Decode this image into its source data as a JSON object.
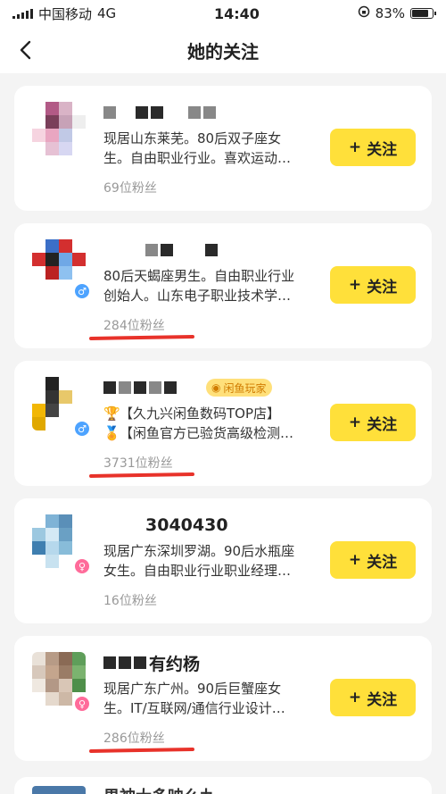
{
  "status": {
    "carrier": "中国移动",
    "network": "4G",
    "time": "14:40",
    "battery": "83%",
    "battery_level": 0.83
  },
  "nav": {
    "title": "她的关注"
  },
  "follow_label": "关注",
  "follow_plus": "+",
  "items": [
    {
      "name": "",
      "desc1": "现居山东莱芜。80后双子座女",
      "desc2": "生。自由职业行业。喜欢运动…",
      "fans": "69位粉丝",
      "gender": "",
      "underlined": false
    },
    {
      "name": "",
      "desc1": "80后天蝎座男生。自由职业行业",
      "desc2": "创始人。山东电子职业技术学…",
      "fans": "284位粉丝",
      "gender": "♂",
      "underlined": true
    },
    {
      "name": "",
      "badge": "闲鱼玩家",
      "desc1": "【久九兴闲鱼数码TOP店】",
      "desc2": "【闲鱼官方已验货高级检测…",
      "fans": "3731位粉丝",
      "gender": "♂",
      "underlined": true
    },
    {
      "name": "3040430",
      "desc1": "现居广东深圳罗湖。90后水瓶座",
      "desc2": "女生。自由职业行业职业经理…",
      "fans": "16位粉丝",
      "gender": "♀",
      "underlined": false
    },
    {
      "name": "有约杨",
      "desc1": "现居广东广州。90后巨蟹座女",
      "desc2": "生。IT/互联网/通信行业设计…",
      "fans": "286位粉丝",
      "gender": "♀",
      "underlined": true
    }
  ],
  "partial_item": {
    "name": "男神大多映么九"
  },
  "colors": {
    "accent": "#ffe03a",
    "underline": "#e8322a"
  }
}
